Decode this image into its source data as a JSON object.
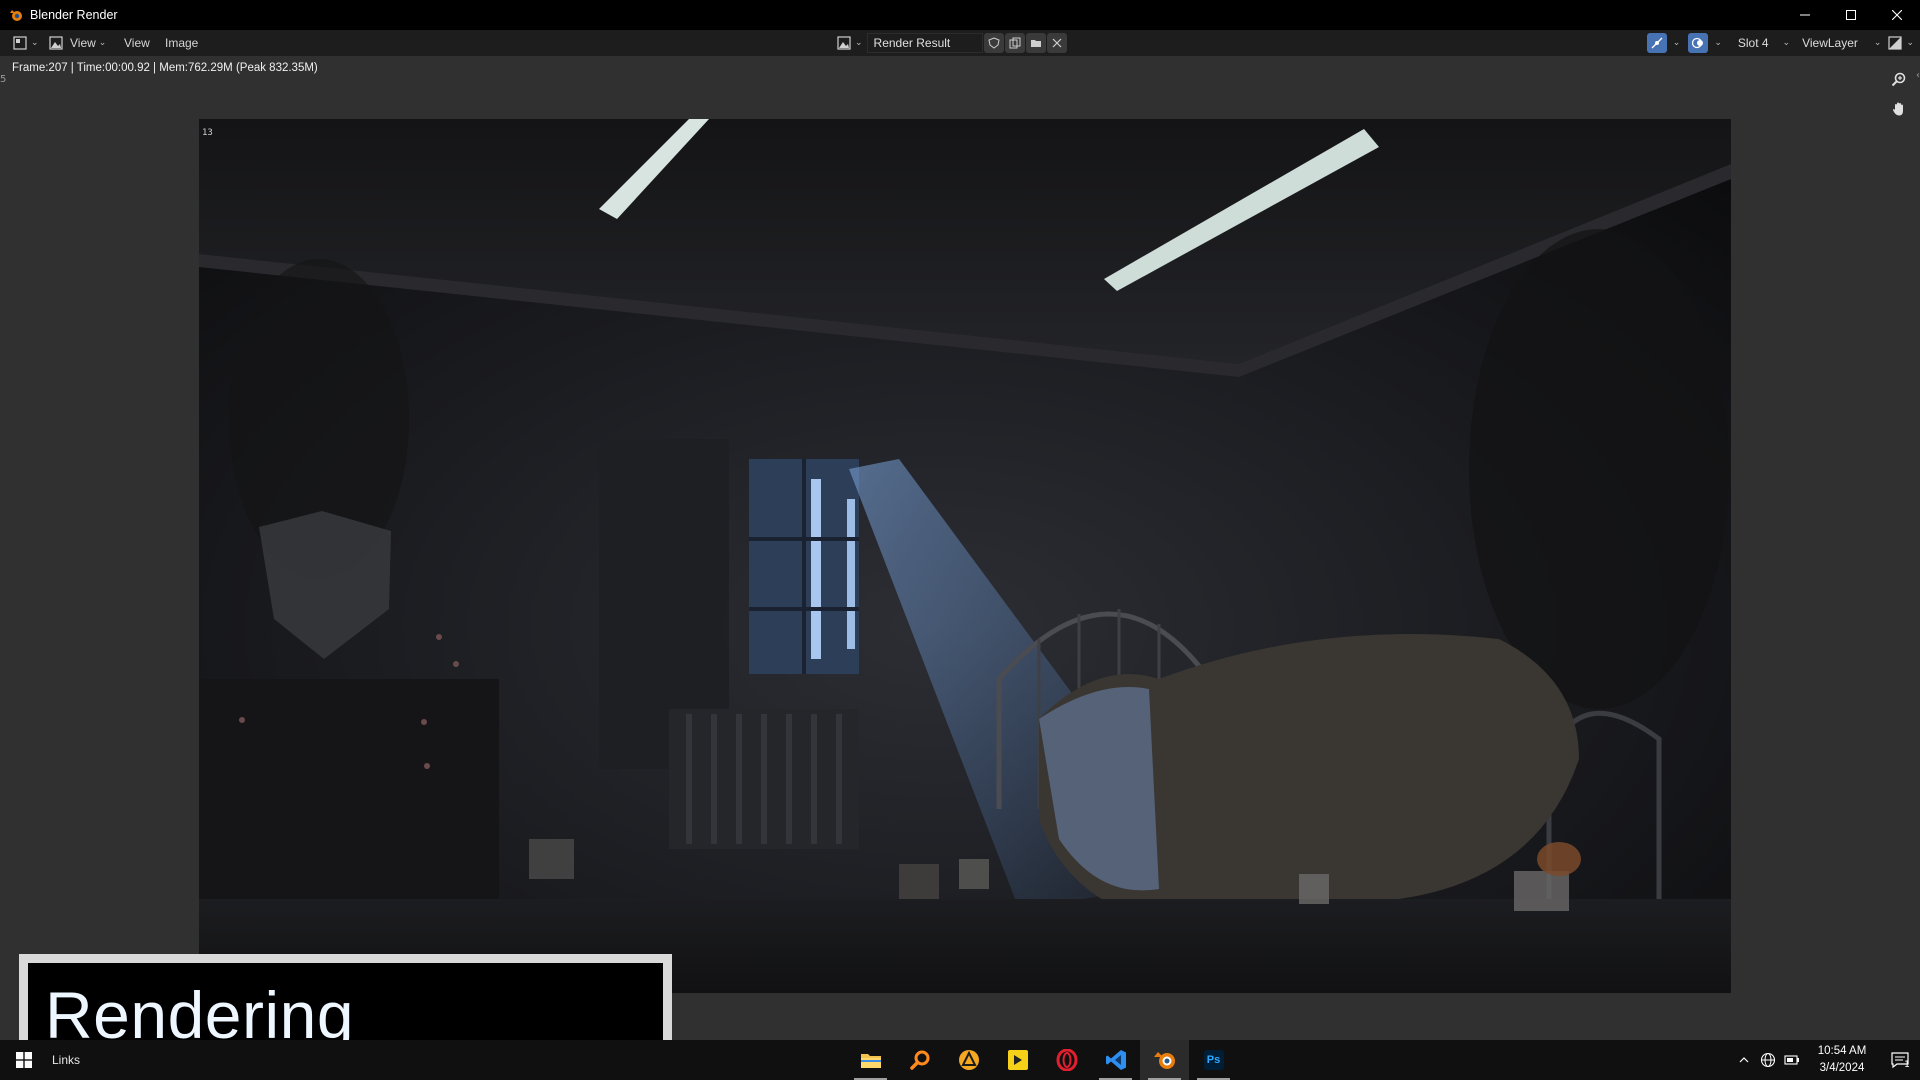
{
  "window": {
    "title": "Blender Render",
    "controls": {
      "minimize": "—",
      "maximize": "☐",
      "close": "✕"
    }
  },
  "header": {
    "editor_type_icon": "image-editor-icon",
    "mode_label": "View",
    "menus": [
      "View",
      "Image"
    ],
    "image_name": "Render Result",
    "slot": "Slot 4",
    "view_layer": "ViewLayer"
  },
  "editor": {
    "stats": "Frame:207 | Time:00:00.92 | Mem:762.29M (Peak 832.35M)",
    "side_tab": "5",
    "tile_counter": "13"
  },
  "overlay": {
    "text": "Rendering"
  },
  "taskbar": {
    "links_label": "Links",
    "apps": [
      {
        "name": "file-explorer-icon",
        "color": "#f2c14e"
      },
      {
        "name": "search-app-icon",
        "color": "#ff8a1d"
      },
      {
        "name": "triangle-app-icon",
        "color": "#f5a623"
      },
      {
        "name": "player-app-icon",
        "color": "#f7d117"
      },
      {
        "name": "opera-icon",
        "color": "#e0202f"
      },
      {
        "name": "vscode-icon",
        "color": "#2f8ff0"
      },
      {
        "name": "blender-icon",
        "color": "#e87d0d"
      },
      {
        "name": "photoshop-icon",
        "color": "#31a8ff"
      }
    ],
    "ps_label": "Ps",
    "time": "10:54 AM",
    "date": "3/4/2024",
    "notification_count": "1"
  },
  "colors": {
    "accent": "#4772b3",
    "titlebar": "#000000",
    "header": "#1d1d1d",
    "editor_bg": "#303030"
  }
}
